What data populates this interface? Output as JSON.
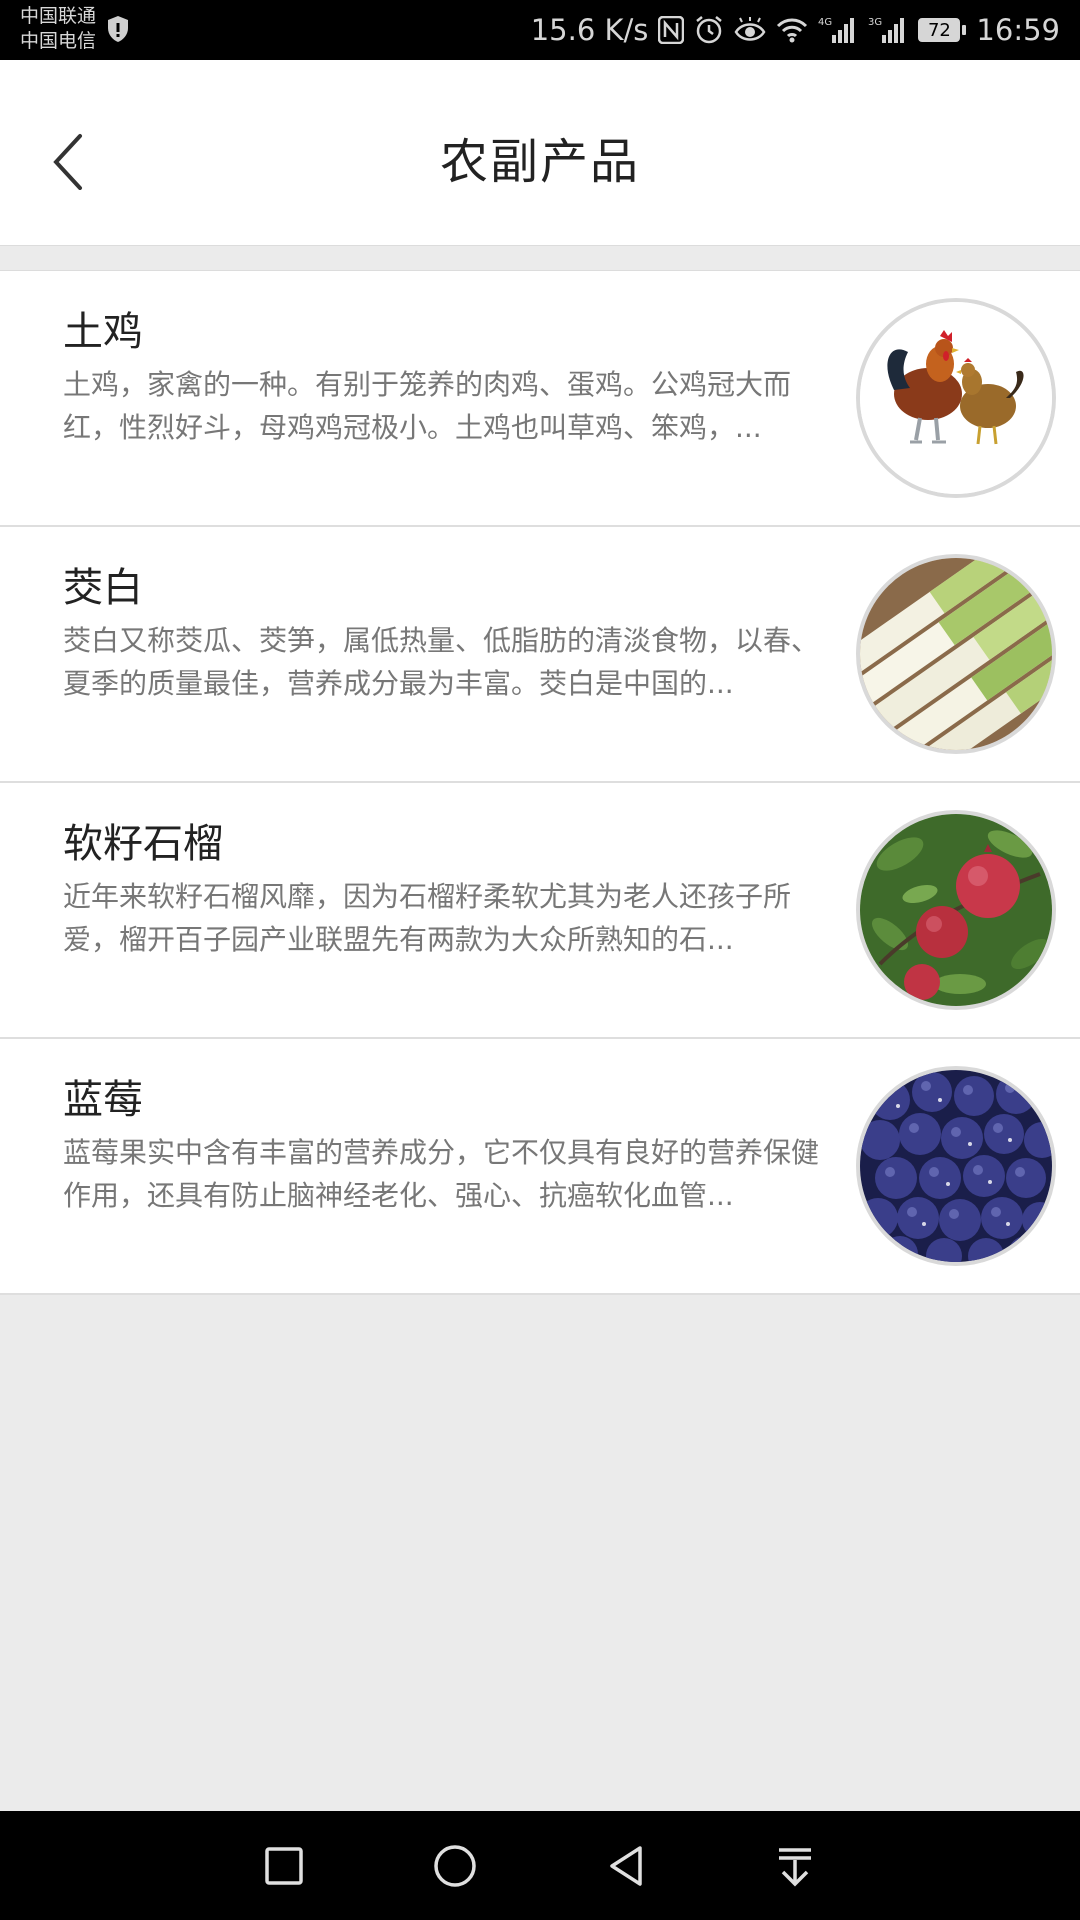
{
  "status_bar": {
    "carrier_1": "中国联通",
    "carrier_2": "中国电信",
    "speed": "15.6 K/s",
    "battery": "72",
    "time": "16:59",
    "net_1": "4G",
    "net_2": "3G"
  },
  "header": {
    "title": "农副产品"
  },
  "items": [
    {
      "title": "土鸡",
      "desc": "土鸡，家禽的一种。有别于笼养的肉鸡、蛋鸡。公鸡冠大而红，性烈好斗，母鸡鸡冠极小。土鸡也叫草鸡、笨鸡，..."
    },
    {
      "title": "茭白",
      "desc": "茭白又称茭瓜、茭笋，属低热量、低脂肪的清淡食物，以春、夏季的质量最佳，营养成分最为丰富。茭白是中国的..."
    },
    {
      "title": "软籽石榴",
      "desc": "近年来软籽石榴风靡，因为石榴籽柔软尤其为老人还孩子所爱，榴开百子园产业联盟先有两款为大众所熟知的石..."
    },
    {
      "title": "蓝莓",
      "desc": "蓝莓果实中含有丰富的营养成分，它不仅具有良好的营养保健作用，还具有防止脑神经老化、强心、抗癌软化血管..."
    }
  ],
  "colors": {
    "background": "#ebebeb",
    "card": "#ffffff",
    "title_text": "#222222",
    "desc_text": "#777777"
  }
}
